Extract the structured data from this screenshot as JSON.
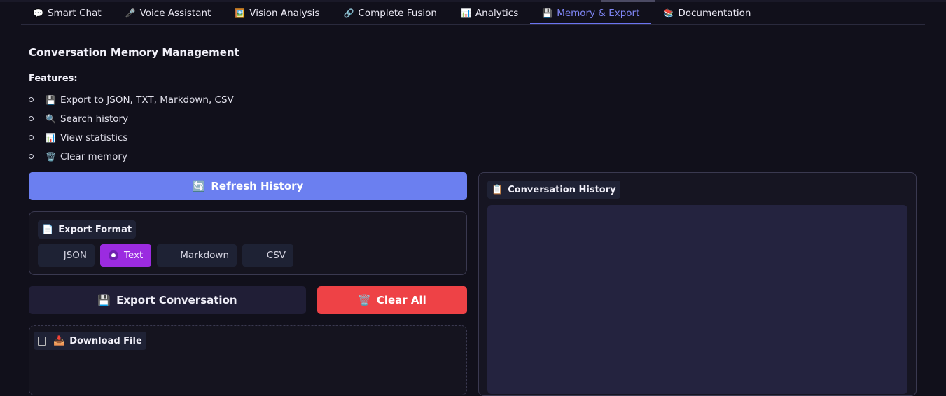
{
  "tabs": [
    {
      "icon": "💬",
      "label": "Smart Chat"
    },
    {
      "icon": "🎤",
      "label": "Voice Assistant"
    },
    {
      "icon": "🖼️",
      "label": "Vision Analysis"
    },
    {
      "icon": "🔗",
      "label": "Complete Fusion"
    },
    {
      "icon": "📊",
      "label": "Analytics"
    },
    {
      "icon": "💾",
      "label": "Memory & Export"
    },
    {
      "icon": "📚",
      "label": "Documentation"
    }
  ],
  "active_tab": "Memory & Export",
  "main": {
    "heading": "Conversation Memory Management",
    "features_label": "Features:",
    "features": [
      {
        "icon": "💾",
        "text": "Export to JSON, TXT, Markdown, CSV"
      },
      {
        "icon": "🔍",
        "text": "Search history"
      },
      {
        "icon": "📊",
        "text": "View statistics"
      },
      {
        "icon": "🗑️",
        "text": "Clear memory"
      }
    ]
  },
  "buttons": {
    "refresh": {
      "icon": "🔄",
      "label": "Refresh History"
    },
    "export": {
      "icon": "💾",
      "label": "Export Conversation"
    },
    "clear": {
      "icon": "🗑️",
      "label": "Clear All"
    }
  },
  "export_format": {
    "icon": "📄",
    "label": "Export Format",
    "options": [
      "JSON",
      "Text",
      "Markdown",
      "CSV"
    ],
    "selected": "Text"
  },
  "download": {
    "icon": "📥",
    "label": "Download File"
  },
  "history": {
    "icon": "📋",
    "label": "Conversation History"
  },
  "colors": {
    "accent": "#6b7ff0",
    "active_tab": "#7f86f5",
    "danger": "#ee4246",
    "radio_selected": "#9b2be0",
    "background": "#11101b"
  }
}
